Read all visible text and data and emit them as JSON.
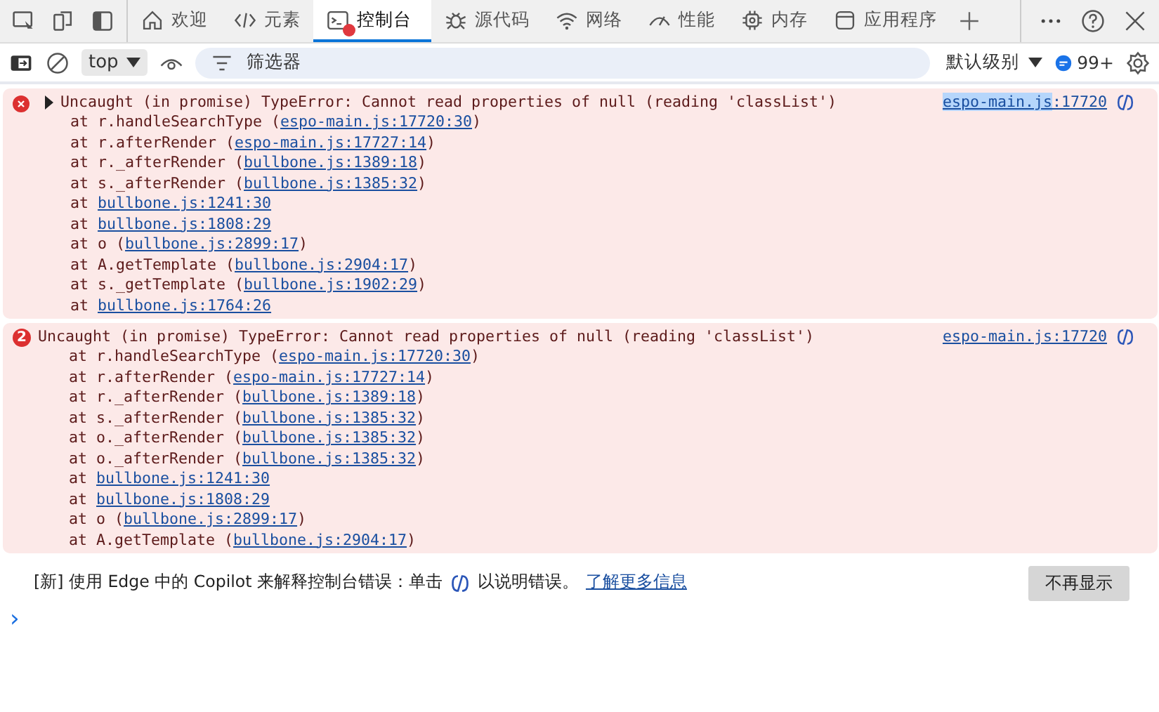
{
  "tabs": [
    {
      "label": "欢迎",
      "selected": false,
      "has_error": false
    },
    {
      "label": "元素",
      "selected": false,
      "has_error": false
    },
    {
      "label": "控制台",
      "selected": true,
      "has_error": true
    },
    {
      "label": "源代码",
      "selected": false,
      "has_error": false
    },
    {
      "label": "网络",
      "selected": false,
      "has_error": false
    },
    {
      "label": "性能",
      "selected": false,
      "has_error": false
    },
    {
      "label": "内存",
      "selected": false,
      "has_error": false
    },
    {
      "label": "应用程序",
      "selected": false,
      "has_error": false
    }
  ],
  "toolbar": {
    "context": "top",
    "filter": {
      "placeholder": "筛选器"
    },
    "level": "默认级别",
    "issues": "99+"
  },
  "messages": [
    {
      "collapsible": true,
      "text": "Uncaught (in promise) TypeError: Cannot read properties of null (reading 'classList')",
      "source": [
        {
          "text": "espo-main.js",
          "highlighted": true
        },
        {
          "text": ":17720",
          "highlighted": false
        }
      ],
      "frames": [
        {
          "prefix": "at r.handleSearchType (",
          "link": "espo-main.js:17720:30",
          "suffix": ")"
        },
        {
          "prefix": "at r.afterRender (",
          "link": "espo-main.js:17727:14",
          "suffix": ")"
        },
        {
          "prefix": "at r._afterRender (",
          "link": "bullbone.js:1389:18",
          "suffix": ")"
        },
        {
          "prefix": "at s._afterRender (",
          "link": "bullbone.js:1385:32",
          "suffix": ")"
        },
        {
          "prefix": "at ",
          "link": "bullbone.js:1241:30"
        },
        {
          "prefix": "at ",
          "link": "bullbone.js:1808:29"
        },
        {
          "prefix": "at o (",
          "link": "bullbone.js:2899:17",
          "suffix": ")"
        },
        {
          "prefix": "at A.getTemplate (",
          "link": "bullbone.js:2904:17",
          "suffix": ")"
        },
        {
          "prefix": "at s._getTemplate (",
          "link": "bullbone.js:1902:29",
          "suffix": ")"
        },
        {
          "prefix": "at ",
          "link": "bullbone.js:1764:26"
        }
      ]
    },
    {
      "collapsible": false,
      "count": "2",
      "text": "Uncaught (in promise) TypeError: Cannot read properties of null (reading 'classList')",
      "source": [
        {
          "text": "espo-main.js:17720",
          "highlighted": false
        }
      ],
      "frames": [
        {
          "prefix": "at r.handleSearchType (",
          "link": "espo-main.js:17720:30",
          "suffix": ")"
        },
        {
          "prefix": "at r.afterRender (",
          "link": "espo-main.js:17727:14",
          "suffix": ")"
        },
        {
          "prefix": "at r._afterRender (",
          "link": "bullbone.js:1389:18",
          "suffix": ")"
        },
        {
          "prefix": "at s._afterRender (",
          "link": "bullbone.js:1385:32",
          "suffix": ")"
        },
        {
          "prefix": "at o._afterRender (",
          "link": "bullbone.js:1385:32",
          "suffix": ")"
        },
        {
          "prefix": "at o._afterRender (",
          "link": "bullbone.js:1385:32",
          "suffix": ")"
        },
        {
          "prefix": "at ",
          "link": "bullbone.js:1241:30"
        },
        {
          "prefix": "at ",
          "link": "bullbone.js:1808:29"
        },
        {
          "prefix": "at o (",
          "link": "bullbone.js:2899:17",
          "suffix": ")"
        },
        {
          "prefix": "at A.getTemplate (",
          "link": "bullbone.js:2904:17",
          "suffix": ")"
        }
      ]
    }
  ],
  "copilot_notice": {
    "before": "[新] 使用 Edge 中的 Copilot 来解释控制台错误：单击",
    "after": "以说明错误。",
    "link": "了解更多信息",
    "button": "不再显示"
  },
  "prompt": "›"
}
